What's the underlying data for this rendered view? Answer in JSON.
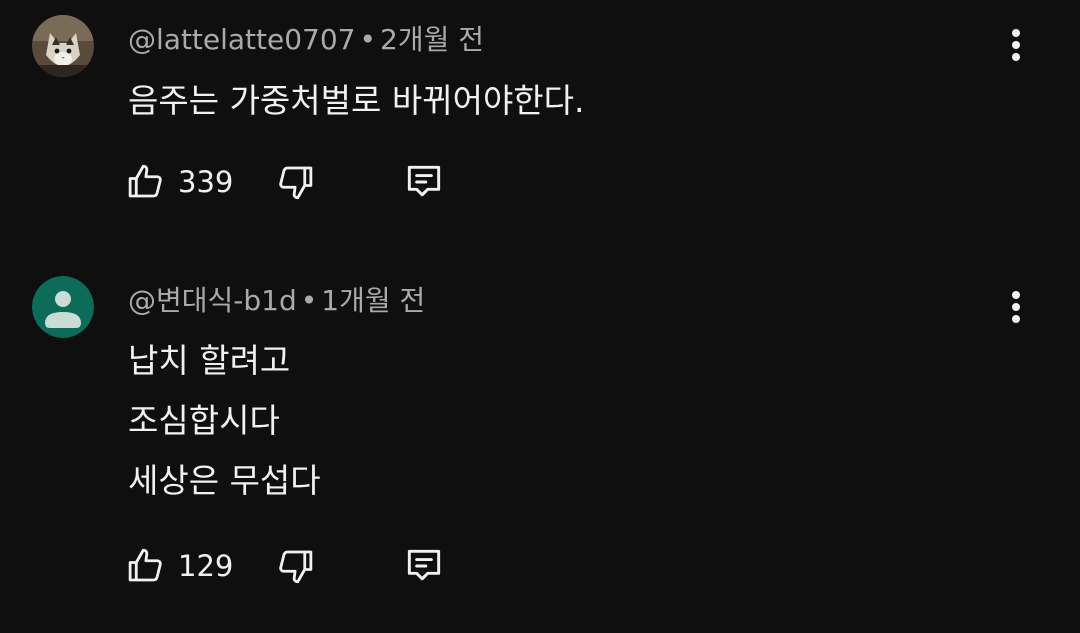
{
  "comments": [
    {
      "author": "@lattelatte0707",
      "separator": "•",
      "time": "2개월 전",
      "lines": [
        "음주는  가중처벌로  바뀌어야한다."
      ],
      "likes": "339",
      "avatar_type": "photo-cat"
    },
    {
      "author": "@변대식-b1d",
      "separator": "•",
      "time": "1개월 전",
      "lines": [
        "납치 할려고",
        "조심합시다",
        "세상은 무섭다"
      ],
      "likes": "129",
      "avatar_type": "default-person",
      "avatar_color": "#0d6b5a"
    }
  ],
  "icons": {
    "like": "thumbs-up-icon",
    "dislike": "thumbs-down-icon",
    "reply": "reply-icon",
    "more": "more-vert-icon"
  },
  "colors": {
    "background": "#0f0f0f",
    "text": "#f1f1f1",
    "secondary_text": "#aaaaaa"
  }
}
